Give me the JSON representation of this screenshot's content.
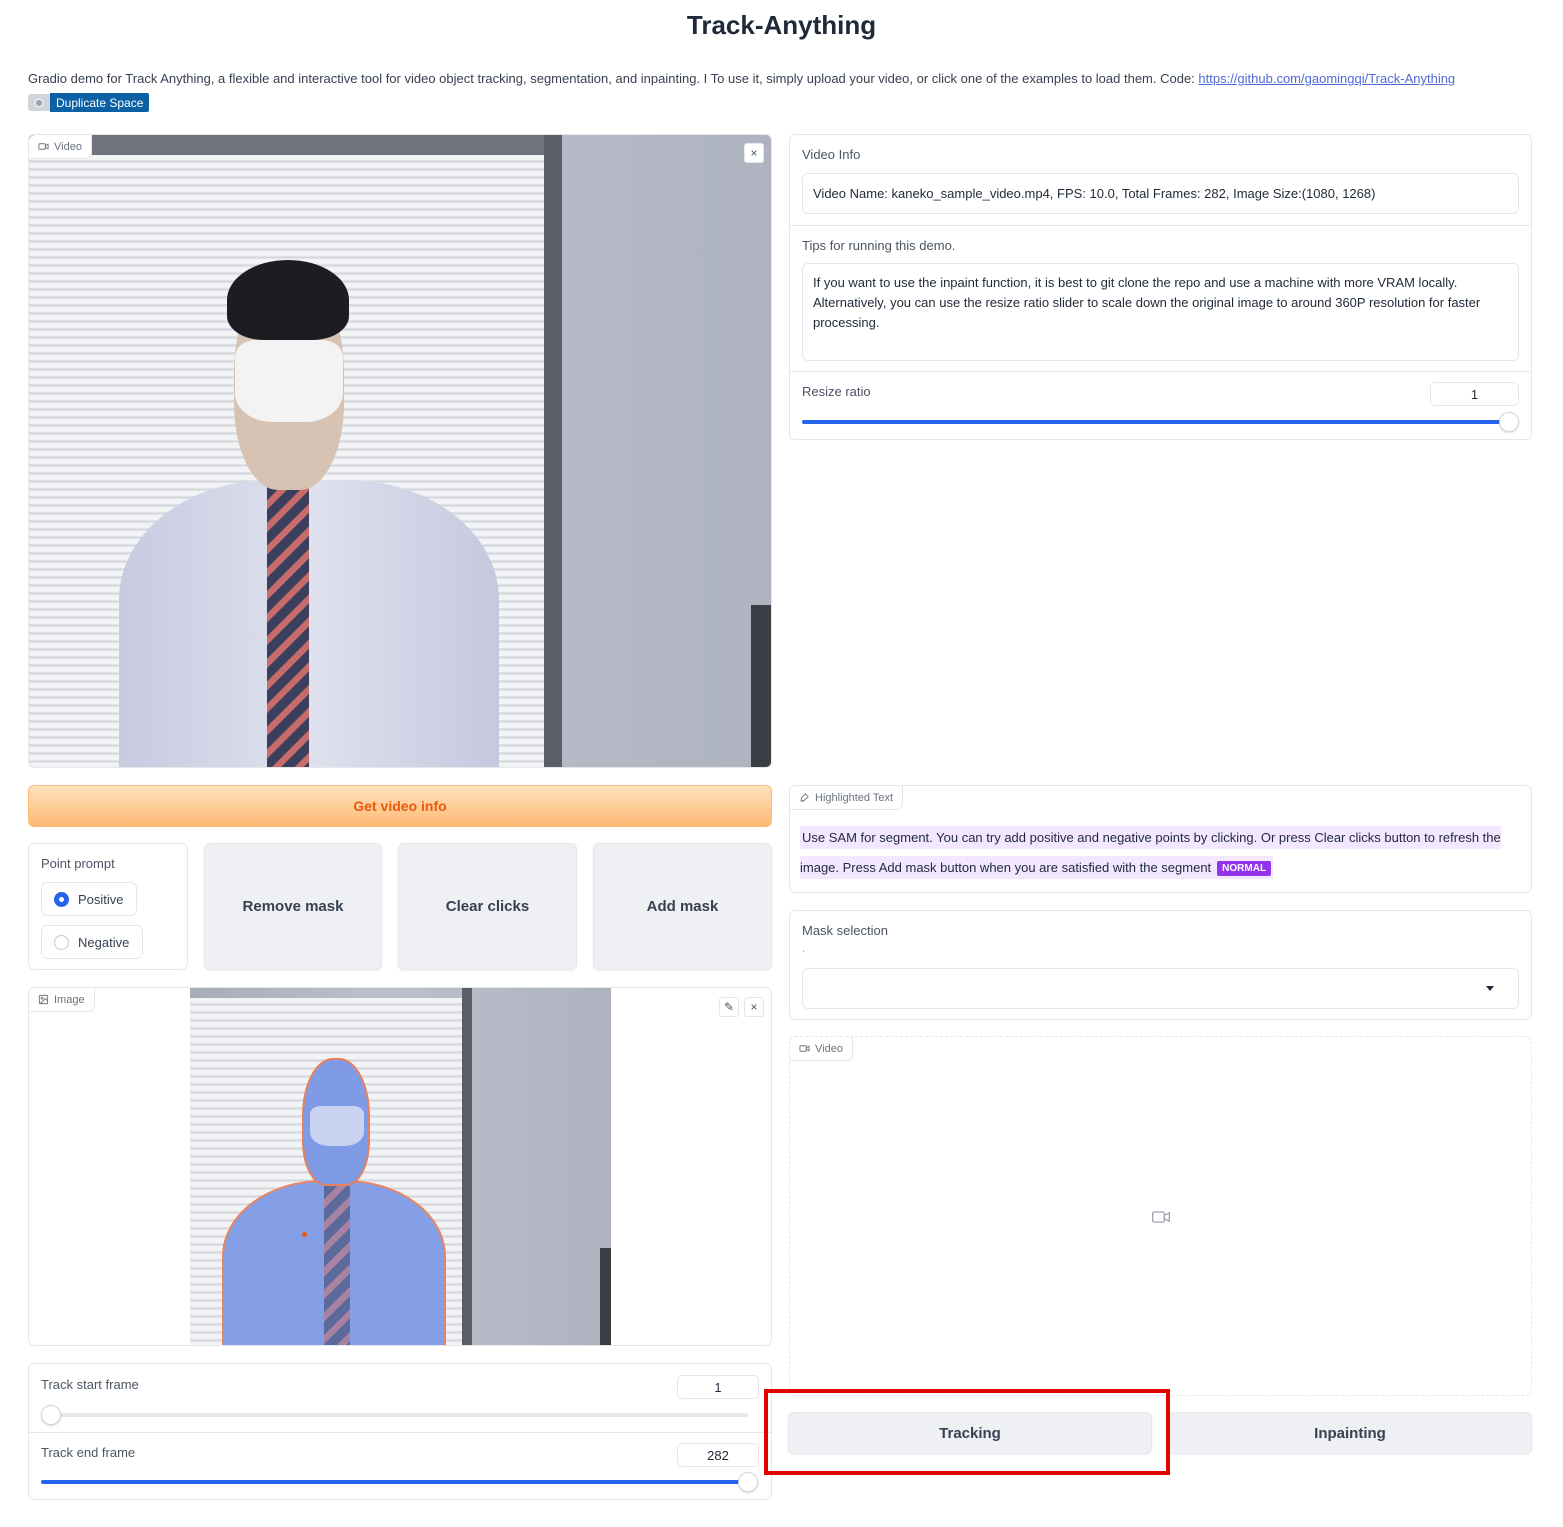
{
  "page": {
    "title": "Track-Anything",
    "description": "Gradio demo for Track Anything, a flexible and interactive tool for video object tracking, segmentation, and inpainting. I To use it, simply upload your video, or click one of the examples to load them. Code: ",
    "code_link": "https://github.com/gaomingqi/Track-Anything",
    "duplicate_label": "Duplicate Space"
  },
  "video_input": {
    "label": "Video",
    "close_icon": "×"
  },
  "video_info": {
    "label": "Video Info",
    "value": "Video Name: kaneko_sample_video.mp4, FPS: 10.0, Total Frames: 282, Image Size:(1080, 1268)"
  },
  "tips": {
    "label": "Tips for running this demo.",
    "value": "If you want to use the inpaint function, it is best to git clone the repo and use a machine with more VRAM locally. Alternatively, you can use the resize ratio slider to scale down the original image to around 360P resolution for faster processing."
  },
  "resize_ratio": {
    "label": "Resize ratio",
    "value": "1",
    "fraction": 1.0
  },
  "get_video_info_button": "Get video info",
  "point_prompt": {
    "label": "Point prompt",
    "options": [
      {
        "label": "Positive",
        "selected": true
      },
      {
        "label": "Negative",
        "selected": false
      }
    ]
  },
  "buttons": {
    "remove_mask": "Remove mask",
    "clear_clicks": "Clear clicks",
    "add_mask": "Add mask",
    "tracking": "Tracking",
    "inpainting": "Inpainting"
  },
  "image_panel": {
    "label": "Image",
    "edit_icon": "✎",
    "close_icon": "×"
  },
  "highlighted_text": {
    "label": "Highlighted Text",
    "text": "Use SAM for segment. You can try add positive and negative points by clicking. Or press Clear clicks button to refresh the image. Press Add mask button when you are satisfied with the segment",
    "badge": "NORMAL"
  },
  "mask_selection": {
    "label": "Mask selection",
    "hint": ".",
    "value": ""
  },
  "video_output": {
    "label": "Video"
  },
  "track_start": {
    "label": "Track start frame",
    "value": "1",
    "fraction": 0.0
  },
  "track_end": {
    "label": "Track end frame",
    "value": "282",
    "fraction": 1.0
  },
  "colors": {
    "accent": "#2563eb",
    "orange": "#ea580c",
    "badge": "#9333ea",
    "highlight": "#e60000"
  }
}
